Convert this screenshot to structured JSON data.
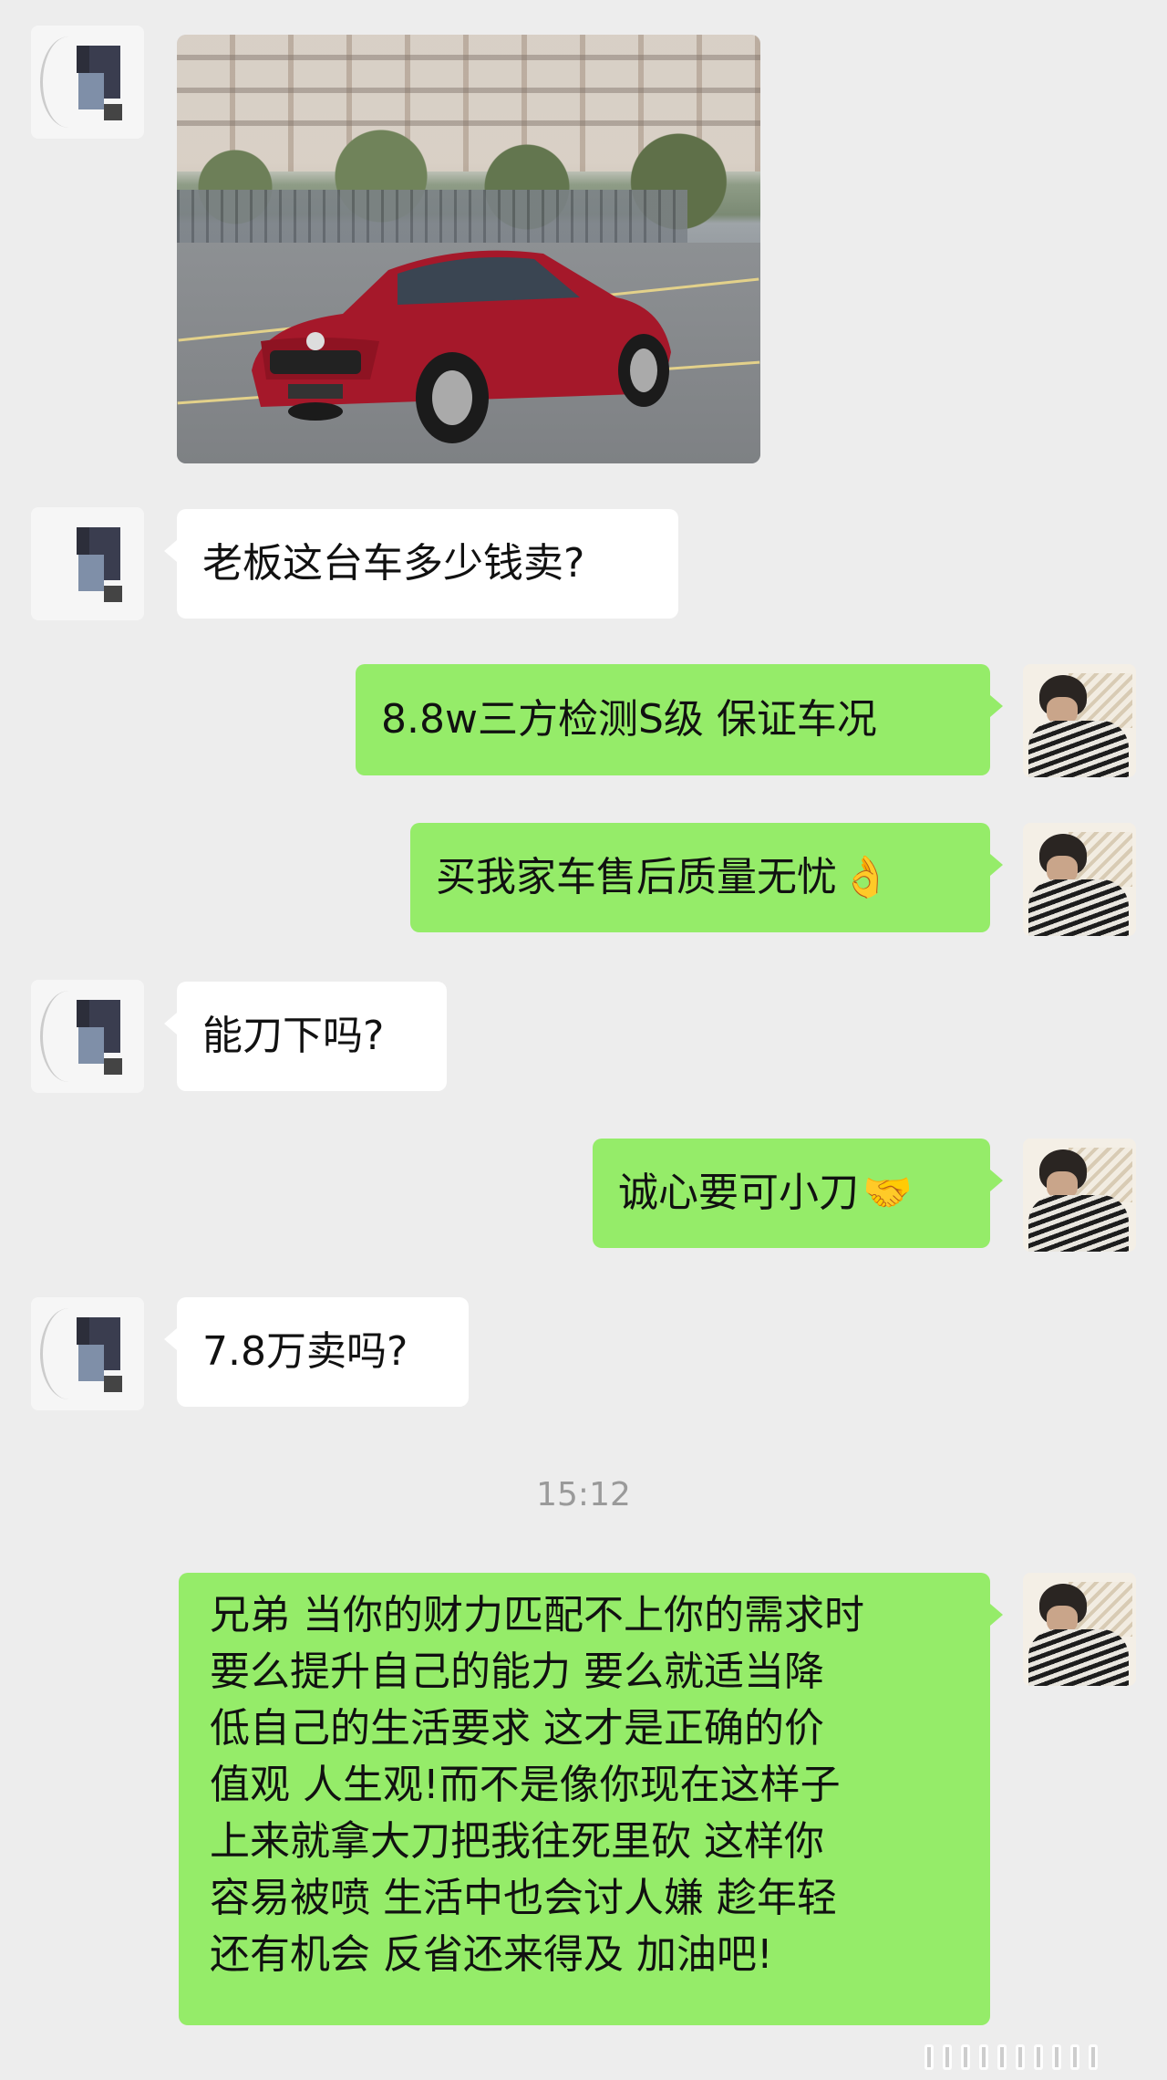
{
  "chat": {
    "messages": [
      {
        "side": "left",
        "type": "image",
        "alt_desc": "red sedan photo"
      },
      {
        "side": "left",
        "type": "text",
        "text": "老板这台车多少钱卖?"
      },
      {
        "side": "right",
        "type": "text",
        "text": "8.8w三方检测S级 保证车况"
      },
      {
        "side": "right",
        "type": "text",
        "text": "买我家车售后质量无忧",
        "emoji": "👌"
      },
      {
        "side": "left",
        "type": "text",
        "text": "能刀下吗?"
      },
      {
        "side": "right",
        "type": "text",
        "text": "诚心要可小刀",
        "emoji": "🤝"
      },
      {
        "side": "left",
        "type": "text",
        "text": "7.8万卖吗?"
      },
      {
        "side": "right",
        "type": "text",
        "lines": [
          "兄弟 当你的财力匹配不上你的需求时",
          "要么提升自己的能力 要么就适当降",
          "低自己的生活要求 这才是正确的价",
          "值观 人生观!而不是像你现在这样子",
          "上来就拿大刀把我往死里砍 这样你",
          "容易被喷 生活中也会讨人嫌 趁年轻",
          "还有机会 反省还来得及 加油吧!"
        ]
      }
    ],
    "timestamp": "15:12"
  },
  "colors": {
    "background": "#ededed",
    "bubble_self": "#95ec69",
    "bubble_other": "#ffffff"
  }
}
